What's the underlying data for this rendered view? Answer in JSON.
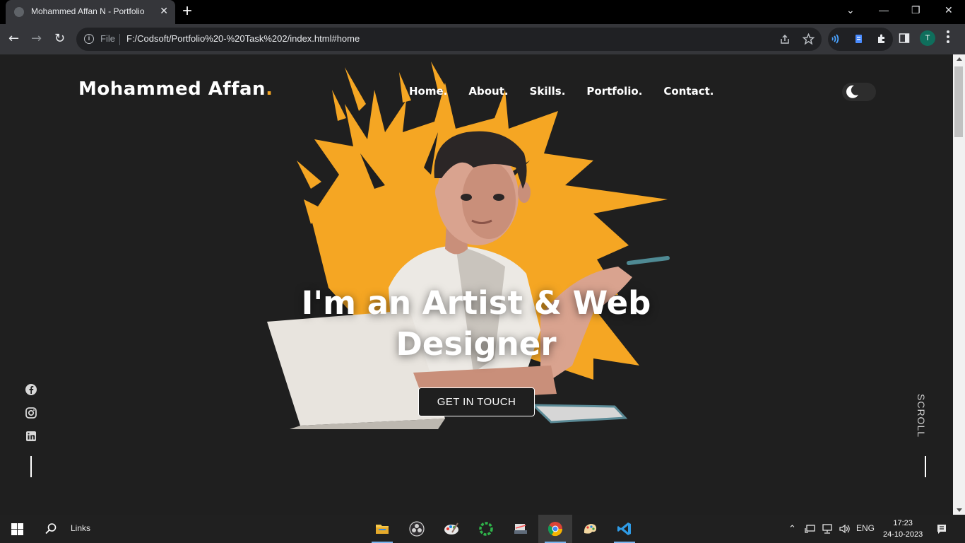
{
  "browser": {
    "tab_title": "Mohammed Affan N - Portfolio",
    "tab_close": "✕",
    "new_tab": "+",
    "window_controls": [
      "⌄",
      "—",
      "❐",
      "✕"
    ],
    "nav_back": "←",
    "nav_forward": "→",
    "nav_reload": "↻",
    "scheme_label": "File",
    "url": "F:/Codsoft/Portfolio%20-%20Task%202/index.html#home",
    "profile_initial": "T"
  },
  "site": {
    "logo_text": "Mohammed Affan",
    "logo_dot": ".",
    "nav": [
      "Home.",
      "About.",
      "Skills.",
      "Portfolio.",
      "Contact."
    ],
    "hero_title_line1": "I'm an Artist & Web",
    "hero_title_line2": "Designer",
    "cta_label": "GET IN TOUCH",
    "scroll_label": "SCROLL",
    "socials": [
      "facebook-icon",
      "instagram-icon",
      "linkedin-icon"
    ],
    "accent_color": "#f5a623",
    "background_color": "#1f1f1f"
  },
  "taskbar": {
    "search_label": "Links",
    "apps": [
      "file-explorer",
      "obs-studio",
      "paint",
      "circle-app",
      "scanner",
      "chrome",
      "paint-3d",
      "vscode"
    ],
    "active_app": "chrome",
    "language": "ENG",
    "time": "17:23",
    "date": "24-10-2023"
  }
}
